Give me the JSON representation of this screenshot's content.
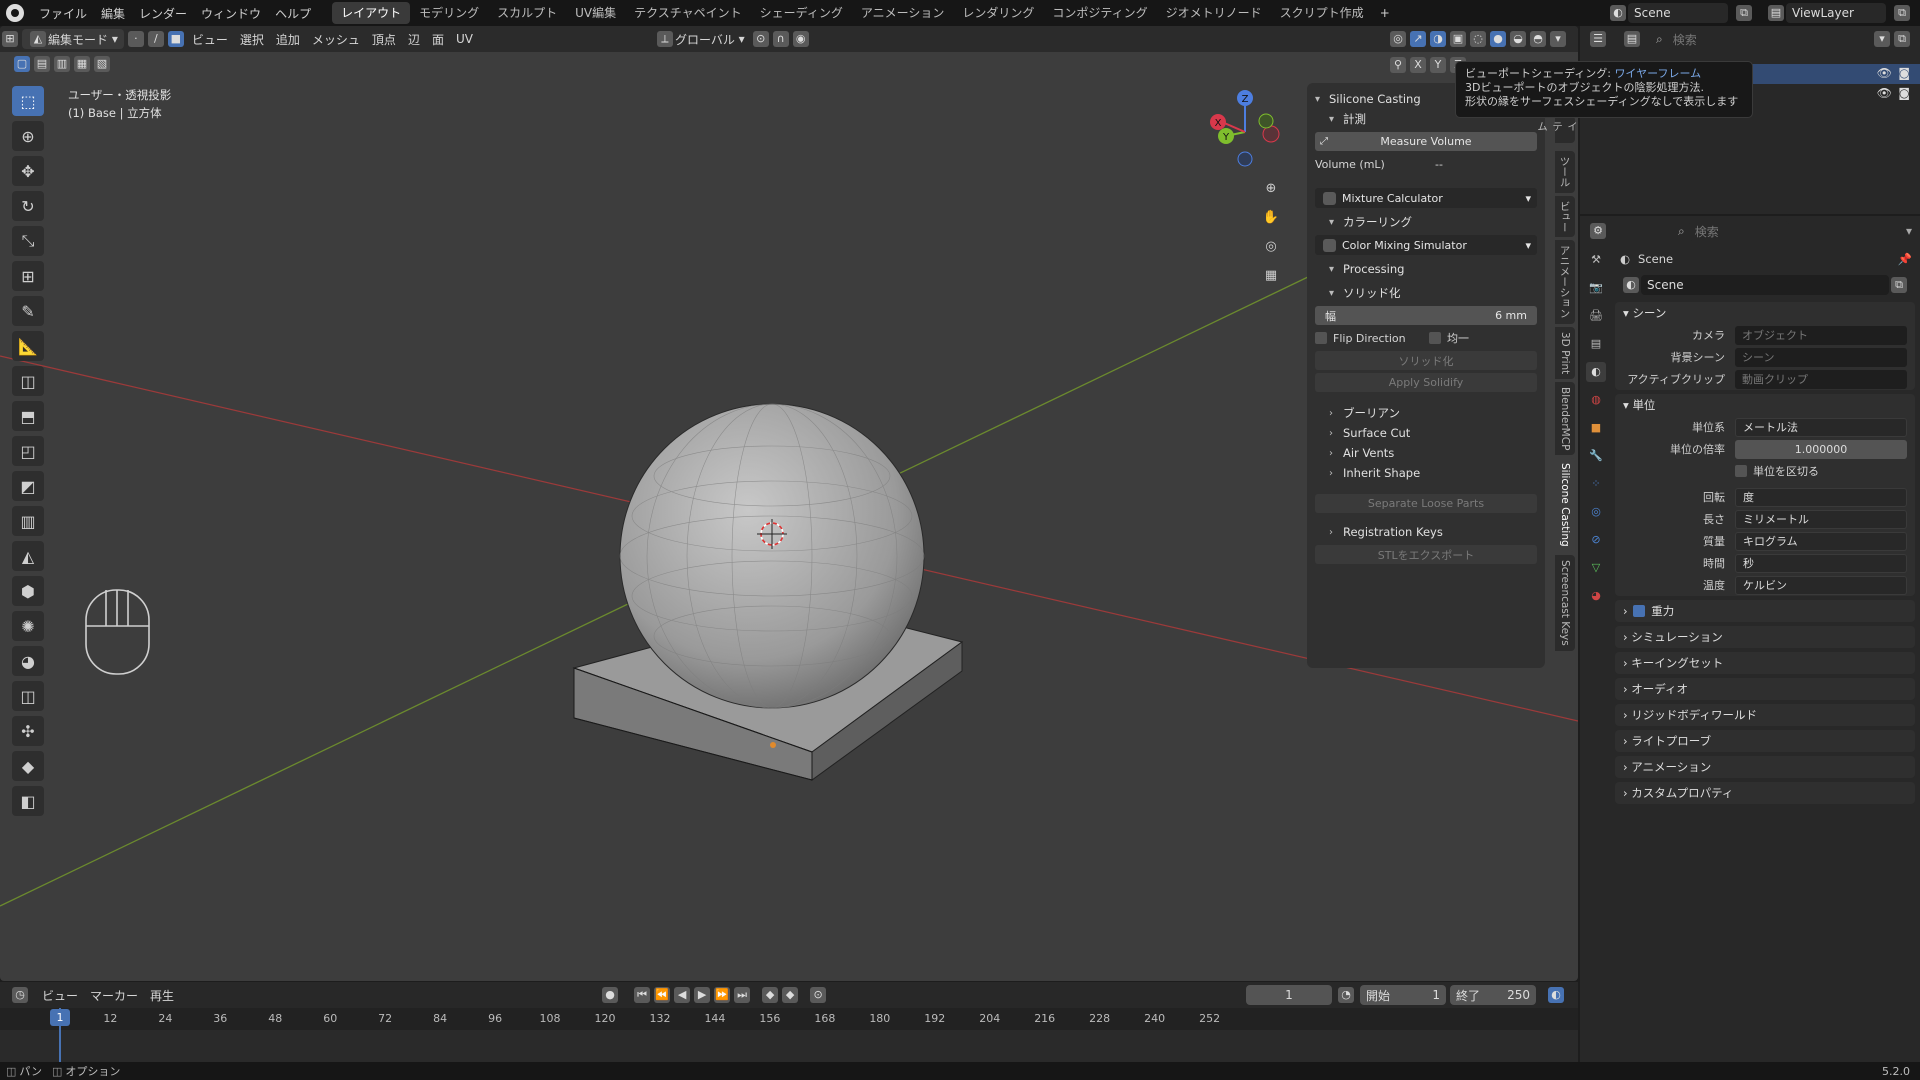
{
  "topbar": {
    "menus": [
      "ファイル",
      "編集",
      "レンダー",
      "ウィンドウ",
      "ヘルプ"
    ],
    "workspaces": [
      "レイアウト",
      "モデリング",
      "スカルプト",
      "UV編集",
      "テクスチャペイント",
      "シェーディング",
      "アニメーション",
      "レンダリング",
      "コンポジティング",
      "ジオメトリノード",
      "スクリプト作成"
    ],
    "active_workspace": "レイアウト",
    "add_workspace": "+",
    "scene": "Scene",
    "viewlayer": "ViewLayer"
  },
  "viewport": {
    "mode": "編集モード",
    "menus": [
      "ビュー",
      "選択",
      "追加",
      "メッシュ",
      "頂点",
      "辺",
      "面",
      "UV"
    ],
    "transform_orientation": "グローバル",
    "overlay_title": "ユーザー・透視投影",
    "overlay_subtitle": "(1) Base | 立方体",
    "axes": [
      "X",
      "Y",
      "Z"
    ],
    "gizmo": {
      "x": "X",
      "y": "Y",
      "z": "Z"
    }
  },
  "npanel": {
    "title": "Silicone Casting",
    "measure_header": "計測",
    "measure_btn": "Measure Volume",
    "volume_label": "Volume (mL)",
    "volume_value": "--",
    "mixture": "Mixture Calculator",
    "coloring_header": "カラーリング",
    "color_mixing": "Color Mixing Simulator",
    "processing": "Processing",
    "solidify_header": "ソリッド化",
    "width_label": "幅",
    "width_value": "6 mm",
    "flip_direction": "Flip Direction",
    "even": "均一",
    "solidify_btn": "ソリッド化",
    "apply_solidify": "Apply Solidify",
    "boolean": "ブーリアン",
    "surface_cut": "Surface Cut",
    "air_vents": "Air Vents",
    "inherit_shape": "Inherit Shape",
    "separate_loose": "Separate Loose Parts",
    "registration_keys": "Registration Keys",
    "export_stl": "STLをエクスポート"
  },
  "vtabs": [
    "ツール",
    "ビュー",
    "アニメーション",
    "3D Print",
    "BlenderMCP",
    "Silicone Casting",
    "Screencast Keys"
  ],
  "vtab_top": "アイテム",
  "tooltip": {
    "title": "ビューポートシェーディング: ",
    "title_value": "ワイヤーフレーム",
    "line1": "3Dビューポートのオブジェクトの陰影処理方法.",
    "line2": "形状の縁をサーフェスシェーディングなしで表示します"
  },
  "outliner": {
    "search_placeholder": "検索"
  },
  "props": {
    "search_placeholder": "検索",
    "scene_title": "Scene",
    "scene_name": "Scene",
    "scene_section": "シーン",
    "camera_label": "カメラ",
    "camera_value": "オブジェクト",
    "bg_label": "背景シーン",
    "bg_value": "シーン",
    "clip_label": "アクティブクリップ",
    "clip_value": "動画クリップ",
    "units_section": "単位",
    "unit_system_label": "単位系",
    "unit_system_value": "メートル法",
    "scale_label": "単位の倍率",
    "scale_value": "1.000000",
    "separate_units": "単位を区切る",
    "rotation_label": "回転",
    "rotation_value": "度",
    "length_label": "長さ",
    "length_value": "ミリメートル",
    "mass_label": "質量",
    "mass_value": "キログラム",
    "time_label": "時間",
    "time_value": "秒",
    "temp_label": "温度",
    "temp_value": "ケルビン",
    "collapsed": [
      "重力",
      "シミュレーション",
      "キーイングセット",
      "オーディオ",
      "リジッドボディワールド",
      "ライトプローブ",
      "アニメーション",
      "カスタムプロパティ"
    ]
  },
  "timeline": {
    "menus": [
      "ビュー",
      "マーカー",
      "再生"
    ],
    "current_frame": "1",
    "start_label": "開始",
    "start": "1",
    "end_label": "終了",
    "end": "250",
    "ticks": [
      "1",
      "12",
      "24",
      "36",
      "48",
      "60",
      "72",
      "84",
      "96",
      "108",
      "120",
      "132",
      "144",
      "156",
      "168",
      "180",
      "192",
      "204",
      "216",
      "228",
      "240",
      "252"
    ]
  },
  "status": {
    "pan": "パン",
    "options": "オプション",
    "version": "5.2.0"
  }
}
